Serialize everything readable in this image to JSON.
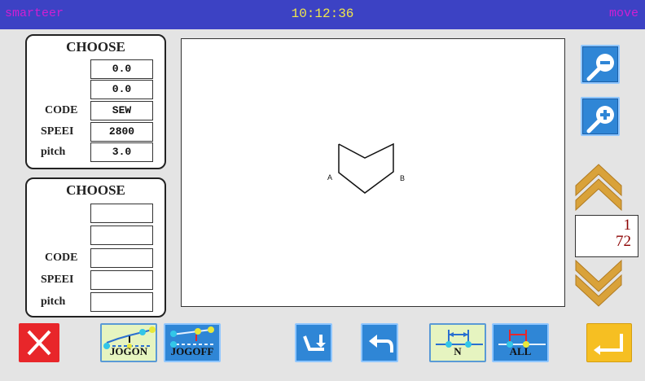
{
  "topbar": {
    "left": "smarteer",
    "time": "10:12:36",
    "right": "move"
  },
  "panel1": {
    "title": "CHOOSE",
    "rows": [
      {
        "label": "",
        "value": "0.0"
      },
      {
        "label": "",
        "value": "0.0"
      },
      {
        "label": "CODE",
        "value": "SEW"
      },
      {
        "label": "SPEEI",
        "value": "2800"
      },
      {
        "label": "pitch",
        "value": "3.0"
      }
    ]
  },
  "panel2": {
    "title": "CHOOSE",
    "rows": [
      {
        "label": "",
        "value": ""
      },
      {
        "label": "",
        "value": ""
      },
      {
        "label": "CODE",
        "value": ""
      },
      {
        "label": "SPEEI",
        "value": ""
      },
      {
        "label": "pitch",
        "value": ""
      }
    ]
  },
  "canvas": {
    "label_a": "A",
    "label_b": "B"
  },
  "pager": {
    "current": "1",
    "total": "72"
  },
  "buttons": {
    "jogon": "JOGON",
    "jogoff": "JOGOFF",
    "n": "N",
    "all": "ALL"
  },
  "icons": {
    "zoom_out": "zoom-out-icon",
    "zoom_in": "zoom-in-icon",
    "page_up": "chevron-up-icon",
    "page_down": "chevron-down-icon",
    "close": "close-icon",
    "enter": "enter-icon",
    "undo": "undo-icon",
    "move": "move-icon"
  },
  "colors": {
    "topbar": "#3c42c4",
    "time": "#f2e84a",
    "close": "#e8262a",
    "enter": "#f6bf22",
    "button_blue": "#2f86d6",
    "chevron": "#d9a23a"
  }
}
